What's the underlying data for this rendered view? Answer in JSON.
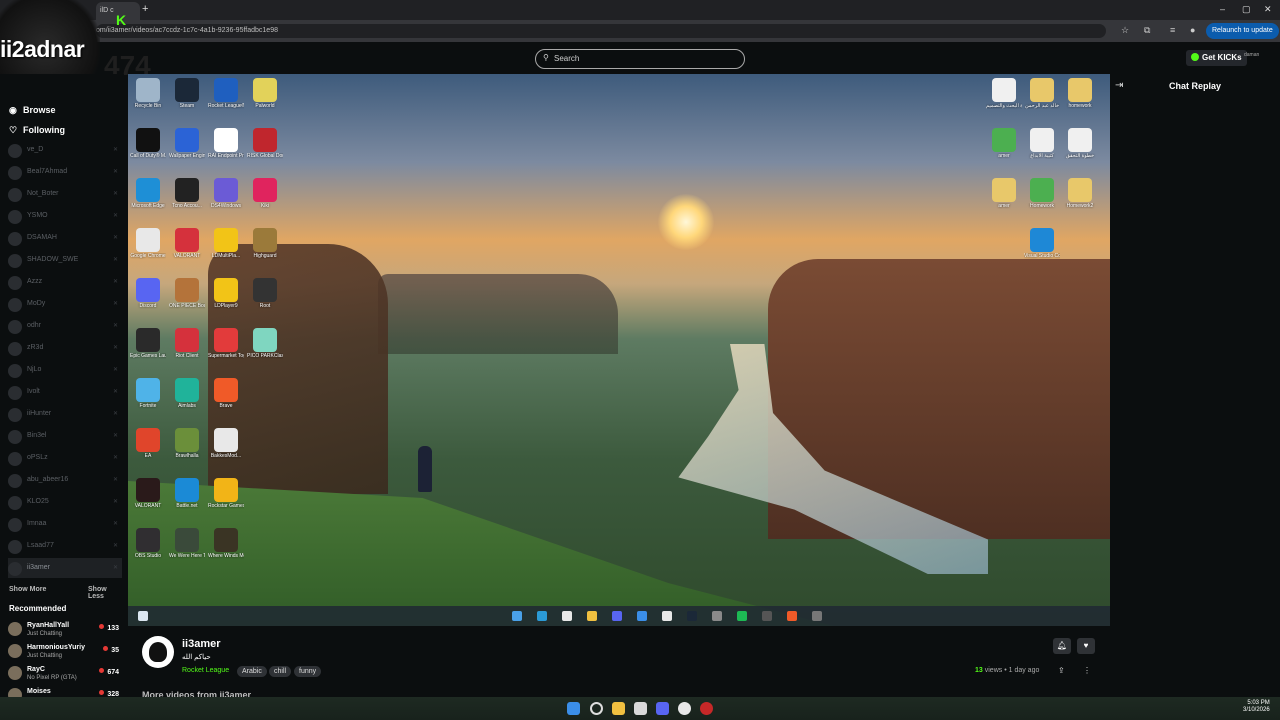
{
  "browser": {
    "tab_title": "ilD c",
    "url": "om/ii3amer/videos/ac7ccdz-1c7c-4a1b-9236-95ffadbc1e98",
    "relaunch_label": "Relaunch to update"
  },
  "overlay": {
    "name": "ii2adnar",
    "number": "474"
  },
  "header": {
    "search_placeholder": "Search",
    "get_kicks_label": "Get KICKs",
    "avatar_text": "daman"
  },
  "sidebar": {
    "browse_label": "Browse",
    "following_label": "Following",
    "channels": [
      {
        "name": "ve_D"
      },
      {
        "name": "Beal7Ahmad"
      },
      {
        "name": "Not_Boter"
      },
      {
        "name": "YSMO"
      },
      {
        "name": "DSAMAH"
      },
      {
        "name": "SHADOW_SWE"
      },
      {
        "name": "Azzz"
      },
      {
        "name": "MoDy"
      },
      {
        "name": "odhr"
      },
      {
        "name": "zR3d"
      },
      {
        "name": "NjLo"
      },
      {
        "name": "Ivolt"
      },
      {
        "name": "iiHunter"
      },
      {
        "name": "Bin3el"
      },
      {
        "name": "oPSLz"
      },
      {
        "name": "abu_abeer16"
      },
      {
        "name": "KLO25"
      },
      {
        "name": "Imnaa"
      },
      {
        "name": "Lsaad77"
      },
      {
        "name": "ii3amer"
      }
    ],
    "show_more_label": "Show More",
    "show_less_label": "Show Less",
    "recommended_title": "Recommended",
    "recommended": [
      {
        "name": "RyanHallYall",
        "category": "Just Chatting",
        "viewers": "133"
      },
      {
        "name": "HarmoniousYuriy",
        "category": "Just Chatting",
        "viewers": "35"
      },
      {
        "name": "RayC",
        "category": "No Pixel RP (GTA)",
        "viewers": "674"
      },
      {
        "name": "Moises",
        "category": "",
        "viewers": "328"
      }
    ]
  },
  "video": {
    "desktop_icons": [
      {
        "label": "Recycle Bin",
        "color": "#9fb5c9"
      },
      {
        "label": "Steam",
        "color": "#1b2838"
      },
      {
        "label": "Rocket League®",
        "color": "#1f5fbf"
      },
      {
        "label": "Palworld",
        "color": "#e2d25a"
      },
      {
        "label": "Call of Duty® M...",
        "color": "#111111"
      },
      {
        "label": "Wallpaper Engine",
        "color": "#2b63d6"
      },
      {
        "label": "RAI Endpoint Protection",
        "color": "#ffffff"
      },
      {
        "label": "RISK Global Domination",
        "color": "#c0262d"
      },
      {
        "label": "Microsoft Edge",
        "color": "#1e8fd6"
      },
      {
        "label": "Tcno Accou...",
        "color": "#222222"
      },
      {
        "label": "DS4Windows",
        "color": "#6b5bd6"
      },
      {
        "label": "Kiki",
        "color": "#e0245e"
      },
      {
        "label": "Google Chrome",
        "color": "#e8e8e8"
      },
      {
        "label": "VALORANT",
        "color": "#d5313c"
      },
      {
        "label": "LDMultiPla...",
        "color": "#f2c417"
      },
      {
        "label": "Highguard",
        "color": "#9b7a3a"
      },
      {
        "label": "Discord",
        "color": "#5865f2"
      },
      {
        "label": "ONE PIECE Bounty Rush",
        "color": "#b4733a"
      },
      {
        "label": "LDPlayer9",
        "color": "#f2c417"
      },
      {
        "label": "Root",
        "color": "#333333"
      },
      {
        "label": "Epic Games Launcher",
        "color": "#2a2a2a"
      },
      {
        "label": "Riot Client",
        "color": "#d5313c"
      },
      {
        "label": "Supermarket Together",
        "color": "#e23b3b"
      },
      {
        "label": "PICO PARKClass...",
        "color": "#7fd6c0"
      },
      {
        "label": "Fortnite",
        "color": "#4fb3e8"
      },
      {
        "label": "Aimlabs",
        "color": "#20b39a"
      },
      {
        "label": "Brave",
        "color": "#f05a28"
      },
      {
        "label": "",
        "color": "transparent"
      },
      {
        "label": "EA",
        "color": "#e0452b"
      },
      {
        "label": "Brawlhalla",
        "color": "#6b8f3a"
      },
      {
        "label": "BakkesMod...",
        "color": "#e8e8e8"
      },
      {
        "label": "",
        "color": "transparent"
      },
      {
        "label": "VALORANT",
        "color": "#2a1a1a"
      },
      {
        "label": "Battle.net",
        "color": "#1b8ad6"
      },
      {
        "label": "Rockstar Games ...",
        "color": "#f2b417"
      },
      {
        "label": "",
        "color": "transparent"
      },
      {
        "label": "OBS Studio",
        "color": "#302e31"
      },
      {
        "label": "We Were Here T...",
        "color": "#3a4a3a"
      },
      {
        "label": "Where Winds Meet",
        "color": "#3a3424"
      }
    ],
    "right_icons": [
      {
        "label": "خطوة البحث والتصميم",
        "color": "#f0f0f0"
      },
      {
        "label": "خالد عبد الرحمن",
        "color": "#e8c86a"
      },
      {
        "label": "homework",
        "color": "#e8c86a"
      },
      {
        "label": "amer",
        "color": "#4caf50"
      },
      {
        "label": "كتيبة الابداع",
        "color": "#f0f0f0"
      },
      {
        "label": "خطوة التحقق",
        "color": "#f0f0f0"
      },
      {
        "label": "amer",
        "color": "#e8c86a"
      },
      {
        "label": "Homework",
        "color": "#4caf50"
      },
      {
        "label": "Homework2",
        "color": "#e8c86a"
      },
      {
        "label": "Visual Studio Code",
        "color": "#1e88d6"
      }
    ]
  },
  "chat": {
    "title": "Chat Replay"
  },
  "stream": {
    "streamer_name": "ii3amer",
    "title": "حياكم الله",
    "category": "Rocket League",
    "tags": [
      "Arabic",
      "chill",
      "funny"
    ],
    "views_count": "13",
    "views_label": "views",
    "age": "1 day ago",
    "more_videos": "More videos from ii3amer"
  },
  "host": {
    "time": "5:03 PM",
    "date": "3/10/2026"
  }
}
